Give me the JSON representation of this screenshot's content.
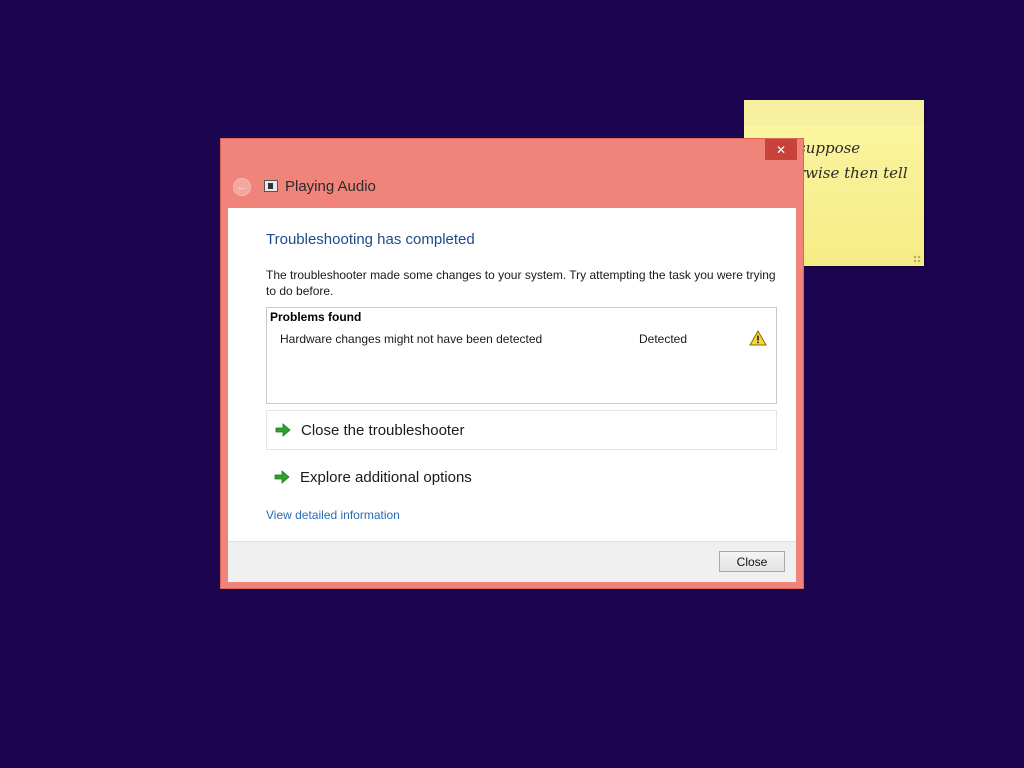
{
  "sticky_note": {
    "text": "suppose\nrwise then tell"
  },
  "window": {
    "title": "Playing Audio",
    "close_glyph": "✕",
    "back_glyph": "←"
  },
  "content": {
    "heading": "Troubleshooting has completed",
    "description": "The troubleshooter made some changes to your system. Try attempting the task you were trying to do before.",
    "problems": {
      "header": "Problems found",
      "items": [
        {
          "description": "Hardware changes might not have been detected",
          "status": "Detected",
          "icon": "warning-icon"
        }
      ]
    },
    "options": [
      {
        "label": "Close the troubleshooter",
        "icon": "green-arrow-icon"
      },
      {
        "label": "Explore additional options",
        "icon": "green-arrow-icon"
      }
    ],
    "link": "View detailed information"
  },
  "footer": {
    "close_button": "Close"
  },
  "colors": {
    "desktop": "#1b0550",
    "window_frame": "#f0837a",
    "heading": "#1e4a8c",
    "link": "#2a6cb8"
  }
}
